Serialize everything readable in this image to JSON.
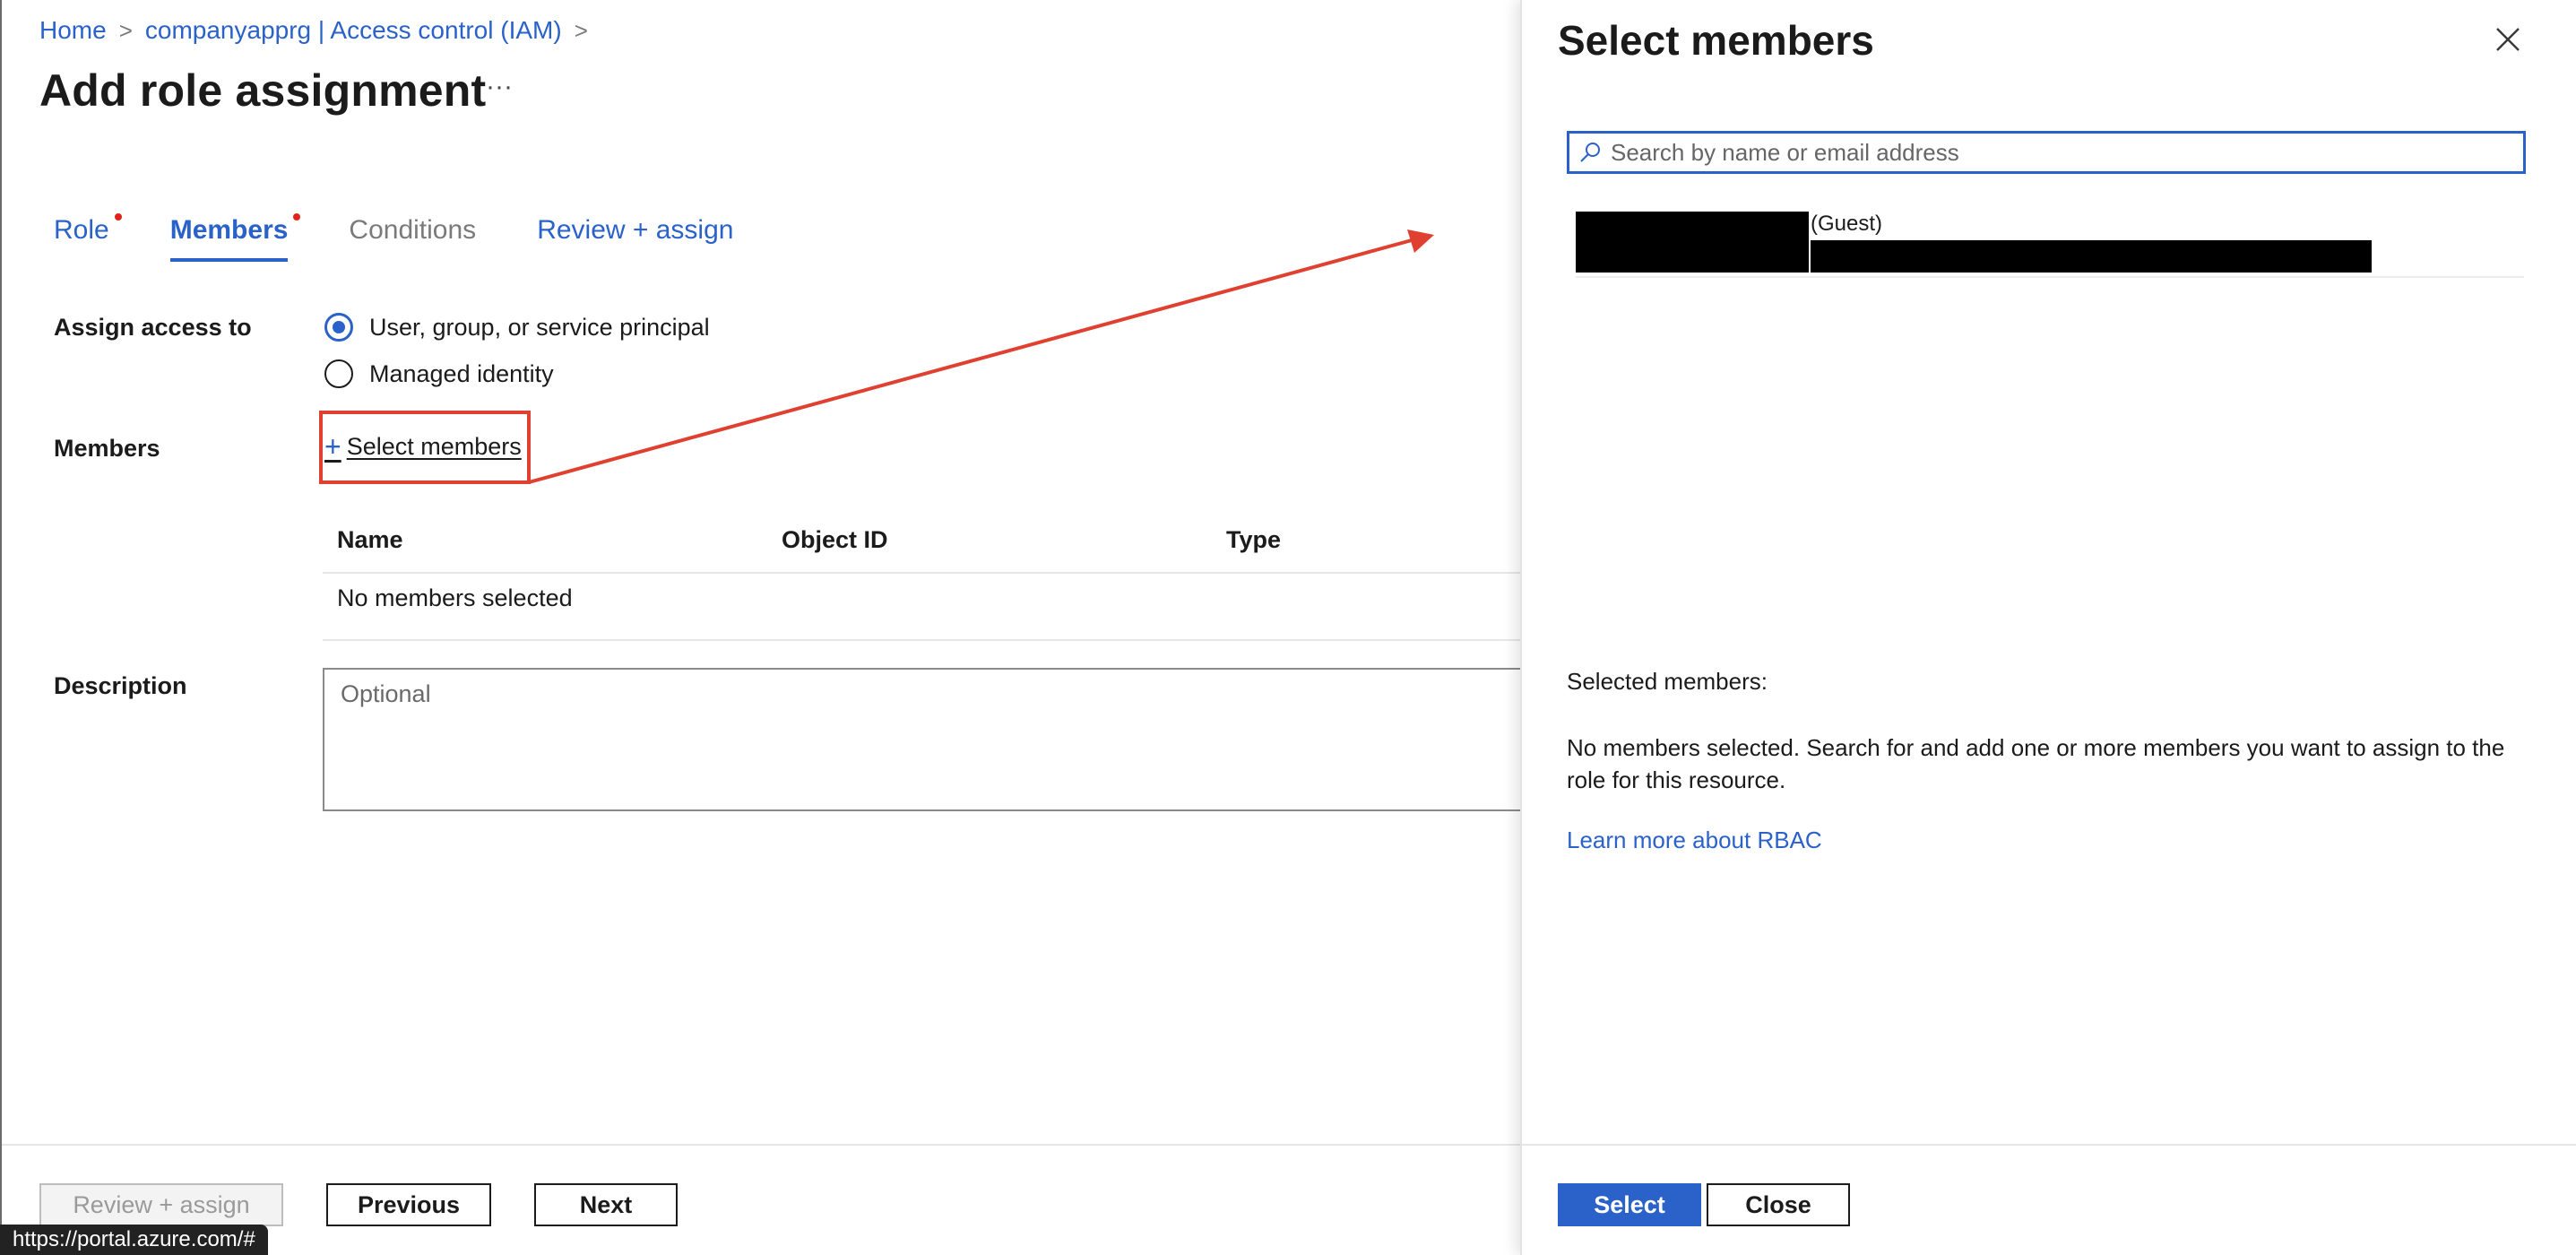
{
  "breadcrumb": {
    "home": "Home",
    "resource": "companyapprg | Access control (IAM)",
    "sep": ">"
  },
  "page": {
    "title": "Add role assignment",
    "more": "···"
  },
  "tabs": [
    {
      "label": "Role",
      "state": "required"
    },
    {
      "label": "Members",
      "state": "active"
    },
    {
      "label": "Conditions",
      "state": "disabled"
    },
    {
      "label": "Review + assign",
      "state": "normal"
    }
  ],
  "form": {
    "assign_access_label": "Assign access to",
    "options": [
      "User, group, or service principal",
      "Managed identity"
    ],
    "selected_option": "User, group, or service principal",
    "members_label": "Members",
    "select_members_link": "Select members",
    "table_headers": [
      "Name",
      "Object ID",
      "Type"
    ],
    "table_empty": "No members selected",
    "description_label": "Description",
    "description_placeholder": "Optional"
  },
  "footer": {
    "review_assign": "Review + assign",
    "previous": "Previous",
    "next": "Next",
    "status_url": "https://portal.azure.com/#"
  },
  "panel": {
    "title": "Select members",
    "search_placeholder": "Search by name or email address",
    "result_suffix": "(Guest)",
    "selected_heading": "Selected members:",
    "empty_message": "No members selected. Search for and add one or more members you want to assign to the role for this resource.",
    "learn_more": "Learn more about RBAC",
    "select_button": "Select",
    "close_button": "Close"
  },
  "colors": {
    "accent": "#2a62c9",
    "annotation": "#e04030",
    "required_dot": "#e2231a"
  }
}
